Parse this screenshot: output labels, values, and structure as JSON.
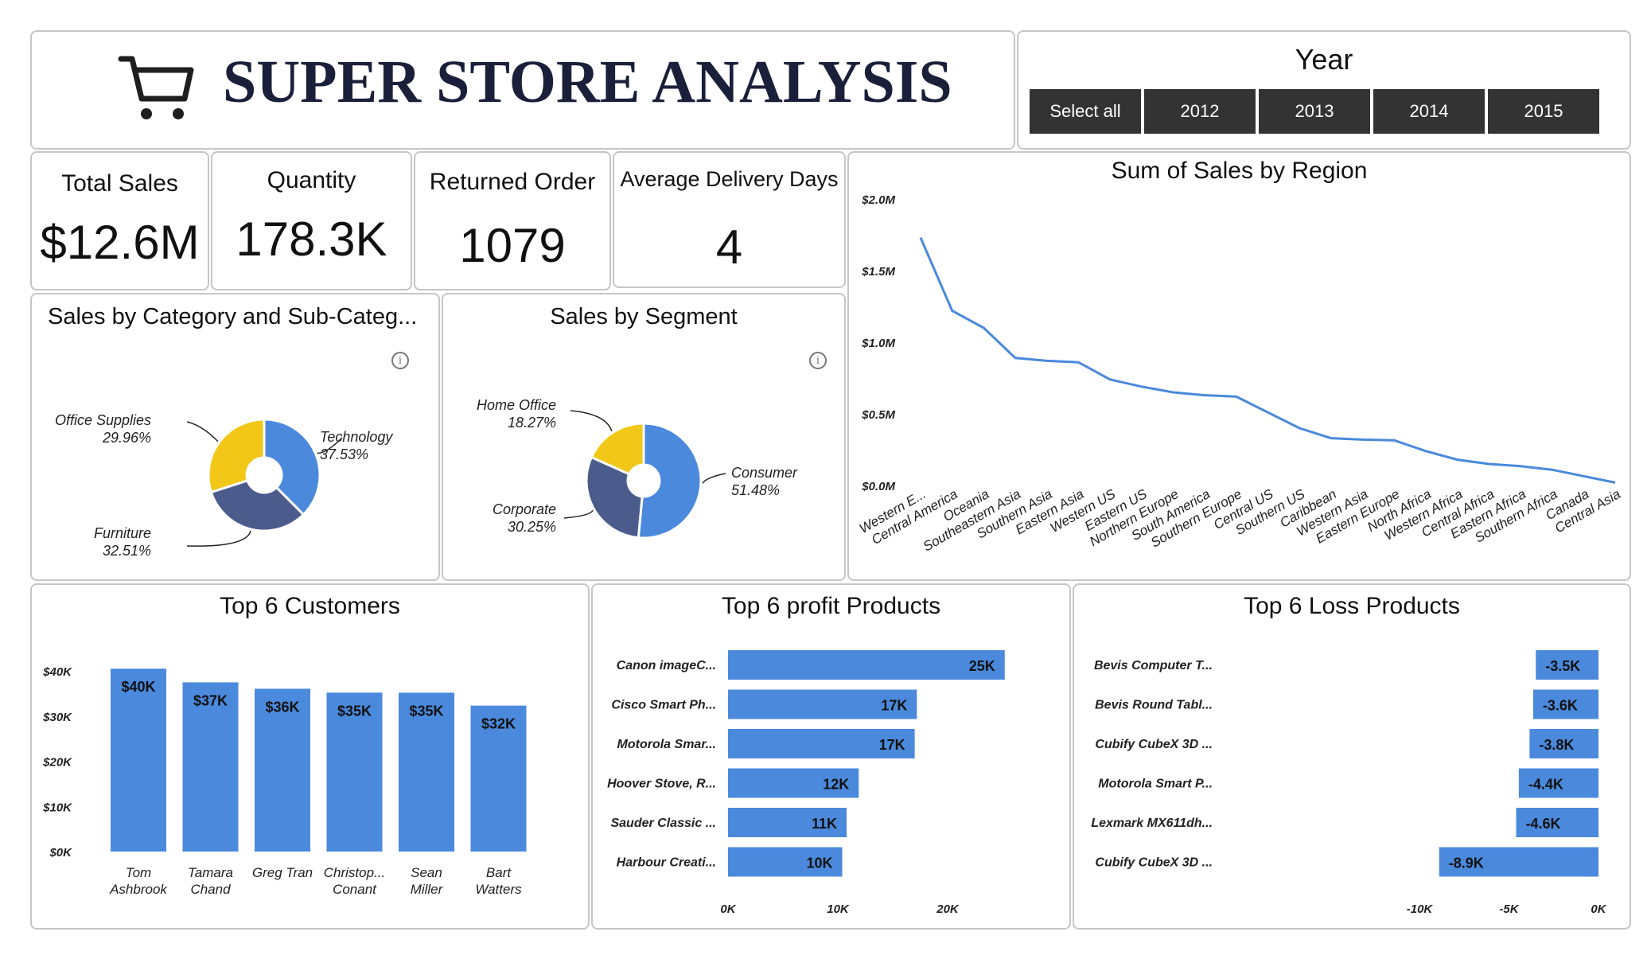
{
  "header": {
    "title": "SUPER STORE ANALYSIS",
    "cart_icon": "shopping-cart-icon"
  },
  "year_filter": {
    "title": "Year",
    "options": [
      "Select all",
      "2012",
      "2013",
      "2014",
      "2015"
    ]
  },
  "kpis": {
    "total_sales": {
      "label": "Total Sales",
      "value": "$12.6M"
    },
    "quantity": {
      "label": "Quantity",
      "value": "178.3K"
    },
    "returned": {
      "label": "Returned Order",
      "value": "1079"
    },
    "delivery": {
      "label": "Average Delivery Days",
      "value": "4"
    }
  },
  "colors": {
    "blue": "#4a89dc",
    "navy": "#4b5c8c",
    "yellow": "#f2c717",
    "dark": "#333333",
    "border": "#c6c6c6"
  },
  "chart_data": [
    {
      "id": "category",
      "type": "pie",
      "title": "Sales by Category and Sub-Categ...",
      "donut": true,
      "slices": [
        {
          "label": "Technology",
          "value": 37.53,
          "display": "37.53%",
          "color": "#4a89dc"
        },
        {
          "label": "Furniture",
          "value": 32.51,
          "display": "32.51%",
          "color": "#4b5c8c"
        },
        {
          "label": "Office Supplies",
          "value": 29.96,
          "display": "29.96%",
          "color": "#f2c717"
        }
      ]
    },
    {
      "id": "segment",
      "type": "pie",
      "title": "Sales by Segment",
      "donut": true,
      "slices": [
        {
          "label": "Consumer",
          "value": 51.48,
          "display": "51.48%",
          "color": "#4a89dc"
        },
        {
          "label": "Corporate",
          "value": 30.25,
          "display": "30.25%",
          "color": "#4b5c8c"
        },
        {
          "label": "Home Office",
          "value": 18.27,
          "display": "18.27%",
          "color": "#f2c717"
        }
      ]
    },
    {
      "id": "region",
      "type": "line",
      "title": "Sum of Sales by Region",
      "xlabel": "",
      "ylabel": "",
      "ylim": [
        0,
        2000000
      ],
      "yticks": [
        {
          "value": 0,
          "label": "$0.0M"
        },
        {
          "value": 500000,
          "label": "$0.5M"
        },
        {
          "value": 1000000,
          "label": "$1.0M"
        },
        {
          "value": 1500000,
          "label": "$1.5M"
        },
        {
          "value": 2000000,
          "label": "$2.0M"
        }
      ],
      "categories": [
        "Western E...",
        "Central America",
        "Oceania",
        "Southeastern Asia",
        "Southern Asia",
        "Eastern Asia",
        "Western US",
        "Eastern US",
        "Northern Europe",
        "South America",
        "Southern Europe",
        "Central US",
        "Southern US",
        "Caribbean",
        "Western Asia",
        "Eastern Europe",
        "North Africa",
        "Western Africa",
        "Central Africa",
        "Eastern Africa",
        "Southern Africa",
        "Canada",
        "Central Asia"
      ],
      "values": [
        1730000,
        1220000,
        1100000,
        890000,
        870000,
        860000,
        740000,
        690000,
        650000,
        630000,
        620000,
        510000,
        400000,
        330000,
        320000,
        315000,
        240000,
        180000,
        150000,
        135000,
        110000,
        65000,
        20000
      ]
    },
    {
      "id": "customers",
      "type": "bar",
      "title": "Top 6 Customers",
      "ylim": [
        0,
        40000
      ],
      "yticks": [
        {
          "value": 0,
          "label": "$0K"
        },
        {
          "value": 10000,
          "label": "$10K"
        },
        {
          "value": 20000,
          "label": "$20K"
        },
        {
          "value": 30000,
          "label": "$30K"
        },
        {
          "value": 40000,
          "label": "$40K"
        }
      ],
      "categories": [
        [
          "Tom",
          "Ashbrook"
        ],
        [
          "Tamara",
          "Chand"
        ],
        [
          "Greg Tran"
        ],
        [
          "Christop...",
          "Conant"
        ],
        [
          "Sean",
          "Miller"
        ],
        [
          "Bart",
          "Watters"
        ]
      ],
      "values": [
        40488,
        37457,
        36050,
        35188,
        35171,
        32310
      ],
      "labels": [
        "$40K",
        "$37K",
        "$36K",
        "$35K",
        "$35K",
        "$32K"
      ]
    },
    {
      "id": "profit",
      "type": "bar",
      "orientation": "horizontal",
      "title": "Top 6 profit Products",
      "xlim": [
        0,
        27000
      ],
      "xticks": [
        {
          "value": 0,
          "label": "0K"
        },
        {
          "value": 10000,
          "label": "10K"
        },
        {
          "value": 20000,
          "label": "20K"
        }
      ],
      "categories": [
        "Canon imageC...",
        "Cisco Smart Ph...",
        "Motorola Smar...",
        "Hoover Stove, R...",
        "Sauder Classic ...",
        "Harbour Creati..."
      ],
      "values": [
        25200,
        17200,
        17000,
        11900,
        10800,
        10400
      ],
      "labels": [
        "25K",
        "17K",
        "17K",
        "12K",
        "11K",
        "10K"
      ]
    },
    {
      "id": "loss",
      "type": "bar",
      "orientation": "horizontal",
      "title": "Top 6 Loss Products",
      "xlim": [
        -10000,
        0
      ],
      "xticks": [
        {
          "value": -10000,
          "label": "-10K"
        },
        {
          "value": -5000,
          "label": "-5K"
        },
        {
          "value": 0,
          "label": "0K"
        }
      ],
      "categories": [
        "Bevis Computer T...",
        "Bevis Round Tabl...",
        "Cubify CubeX 3D ...",
        "Motorola Smart P...",
        "Lexmark MX611dh...",
        "Cubify CubeX 3D ..."
      ],
      "values": [
        -3500,
        -3650,
        -3850,
        -4450,
        -4600,
        -8900
      ],
      "labels": [
        "-3.5K",
        "-3.6K",
        "-3.8K",
        "-4.4K",
        "-4.6K",
        "-8.9K"
      ]
    }
  ]
}
